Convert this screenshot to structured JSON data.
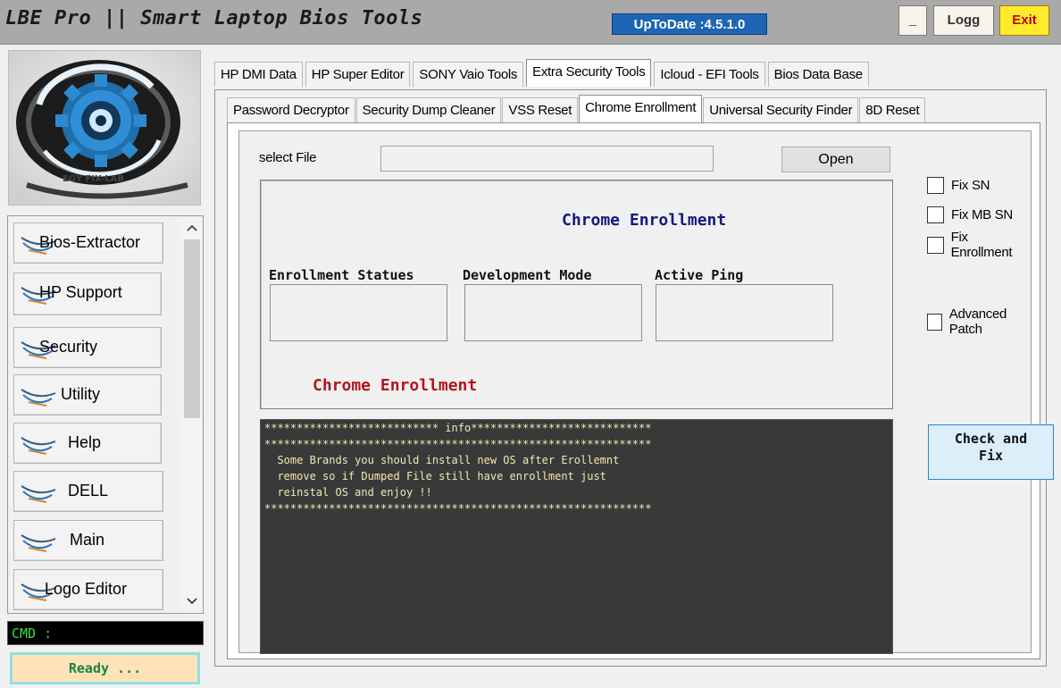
{
  "window": {
    "title": "LBE Pro || Smart Laptop Bios Tools",
    "version_badge": "UpToDate :4.5.1.0",
    "minimize_label": "_",
    "logg_label": "Logg",
    "exit_label": "Exit"
  },
  "logo": {
    "text": "EGY FIX-LAB"
  },
  "sidebar": {
    "items": [
      {
        "label": "Bios-Extractor"
      },
      {
        "label": "HP Support"
      },
      {
        "label": "Security"
      },
      {
        "label": "Utility"
      },
      {
        "label": "Help"
      },
      {
        "label": "DELL"
      },
      {
        "label": "Main"
      },
      {
        "label": "Logo Editor"
      }
    ],
    "scroll_up_icon": "^",
    "scroll_down_icon": "v"
  },
  "status": {
    "cmd_label": "CMD :",
    "ready_label": "Ready ..."
  },
  "outer_tabs": [
    {
      "label": "HP DMI Data"
    },
    {
      "label": "HP Super Editor"
    },
    {
      "label": "SONY Vaio Tools"
    },
    {
      "label": "Extra Security Tools",
      "active": true
    },
    {
      "label": "Icloud - EFI  Tools"
    },
    {
      "label": "Bios Data Base"
    }
  ],
  "inner_tabs": [
    {
      "label": "Password Decryptor"
    },
    {
      "label": "Security Dump Cleaner"
    },
    {
      "label": "VSS Reset"
    },
    {
      "label": "Chrome Enrollment",
      "active": true
    },
    {
      "label": "Universal Security  Finder"
    },
    {
      "label": "8D Reset"
    }
  ],
  "chrome_enrollment": {
    "select_file_label": "select File",
    "file_path_value": "",
    "open_button": "Open",
    "heading": "Chrome Enrollment",
    "columns": [
      {
        "label": "Enrollment Statues",
        "value": ""
      },
      {
        "label": "Development Mode",
        "value": ""
      },
      {
        "label": "Active Ping",
        "value": ""
      }
    ],
    "footer_heading": "Chrome Enrollment",
    "checkboxes": [
      {
        "label": "Fix SN",
        "checked": false
      },
      {
        "label": "Fix MB SN",
        "checked": false
      },
      {
        "label": "Fix Enrollment",
        "checked": false
      },
      {
        "label": "Advanced Patch",
        "checked": false
      }
    ],
    "check_fix_line1": "Check and",
    "check_fix_line2": "Fix",
    "console_lines": [
      "*************************** info****************************",
      "************************************************************",
      "  Some Brands you should install new OS after Erollemnt",
      "  remove so if Dumped File still have enrollment just",
      "  reinstal OS and enjoy !!",
      "************************************************************"
    ]
  },
  "colors": {
    "titlebar_bg": "#a9a9a9",
    "version_bg": "#1e64b4",
    "exit_bg": "#ffea2e",
    "exit_text": "#c00000",
    "heading_blue": "#19177e",
    "heading_red": "#b4141e",
    "console_bg": "#393939",
    "console_text": "#f1e8b4",
    "cmd_text": "#3ce03c",
    "ready_bg": "#ffe2b8",
    "ready_text": "#16863d"
  }
}
